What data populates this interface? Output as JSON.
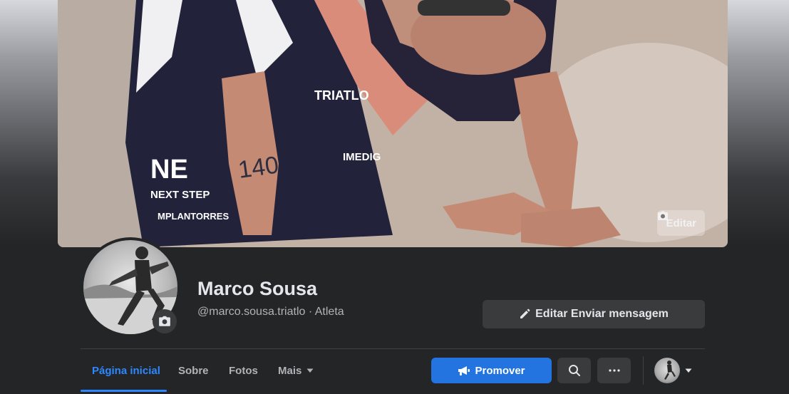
{
  "cover": {
    "edit_label": "Editar"
  },
  "profile": {
    "name": "Marco Sousa",
    "username": "@marco.sousa.triatlo",
    "separator": " · ",
    "category": "Atleta"
  },
  "actions": {
    "edit_message_label": "Editar Enviar mensagem"
  },
  "tabs": [
    {
      "label": "Página inicial",
      "active": true
    },
    {
      "label": "Sobre"
    },
    {
      "label": "Fotos"
    },
    {
      "label": "Mais"
    }
  ],
  "toolbar": {
    "promote_label": "Promover",
    "search_icon": "search-icon",
    "more_icon": "more-icon"
  },
  "colors": {
    "accent": "#2d88ff",
    "promote": "#2374e1",
    "surface": "#242526",
    "button": "#3a3b3c"
  }
}
